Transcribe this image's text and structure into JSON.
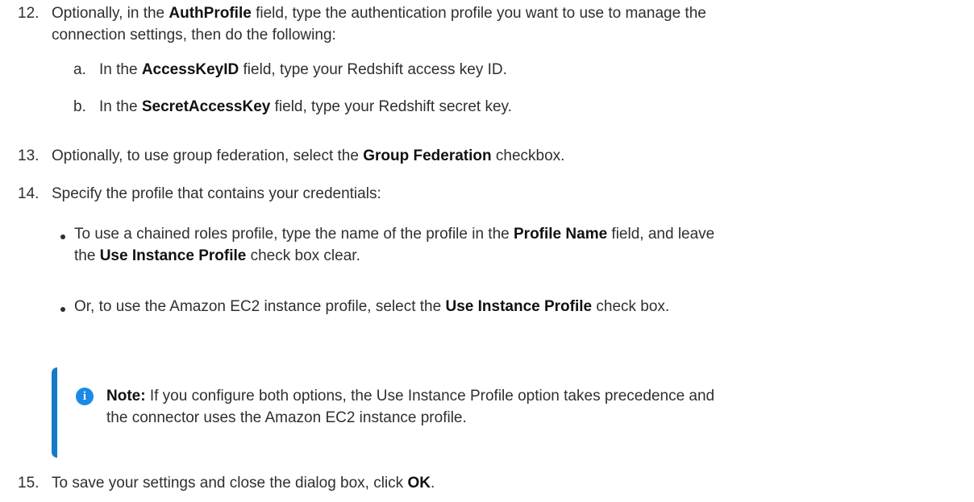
{
  "steps": {
    "s12": {
      "number": "12.",
      "line1_pre": "Optionally, in the ",
      "line1_ui": "AuthProfile",
      "line1_post": " field, type the authentication profile you want to use to manage the",
      "line2": "connection settings, then do the following:",
      "sub_a": {
        "letter": "a.",
        "pre": "In the ",
        "ui": "AccessKeyID",
        "post": " field, type your Redshift access key ID."
      },
      "sub_b": {
        "letter": "b.",
        "pre": "In the ",
        "ui": "SecretAccessKey",
        "post": " field, type your Redshift secret key."
      }
    },
    "s13": {
      "number": "13.",
      "pre": "Optionally, to use group federation, select the ",
      "ui": "Group Federation",
      "post": " checkbox."
    },
    "s14": {
      "number": "14.",
      "text": "Specify the profile that contains your credentials:",
      "bullet1": {
        "pre": "To use a chained roles profile, type the name of the profile in the ",
        "ui1": "Profile Name",
        "mid": " field, and leave",
        "pre2": "the ",
        "ui2": "Use Instance Profile",
        "post2": " check box clear."
      },
      "bullet2": {
        "pre": "Or, to use the Amazon EC2 instance profile, select the ",
        "ui": "Use Instance Profile",
        "post": " check box."
      }
    },
    "note": {
      "label": "Note:",
      "line1": " If you configure both options, the Use Instance Profile option takes precedence and",
      "line2": "the connector uses the Amazon EC2 instance profile.",
      "icon": "info-icon",
      "accent_color": "#1479c6"
    },
    "s15": {
      "number": "15.",
      "pre": "To save your settings and close the dialog box, click ",
      "ui": "OK",
      "post": "."
    }
  }
}
